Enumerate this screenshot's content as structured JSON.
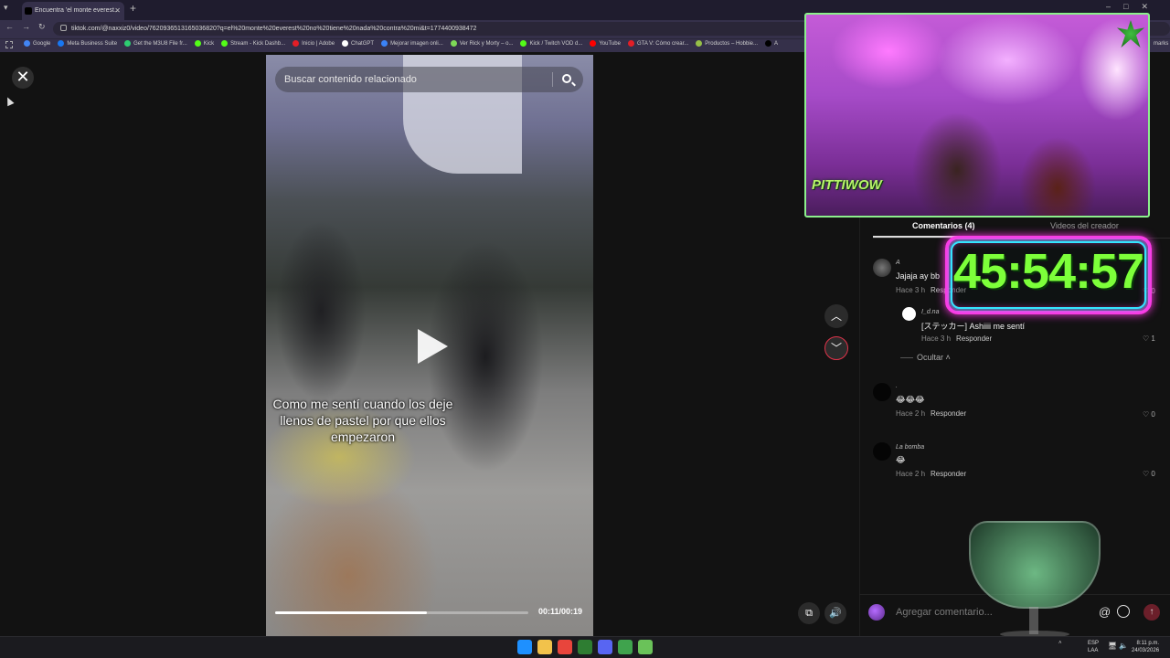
{
  "browser": {
    "tab_title": "Encuentra 'el monte everest...",
    "url": "tiktok.com/@naxxiz0/video/7620936513165036820?q=el%20monte%20everest%20no%20tiene%20nada%20contra%20mi&t=1774400938472",
    "bookmarks": [
      {
        "label": "Google",
        "color": "#4285f4"
      },
      {
        "label": "Meta Business Suite",
        "color": "#1877f2"
      },
      {
        "label": "Get the M3U8 File fr...",
        "color": "#2ecc71"
      },
      {
        "label": "Kick",
        "color": "#53fc18"
      },
      {
        "label": "Stream - Kick Dashb...",
        "color": "#53fc18"
      },
      {
        "label": "Inicio | Adobe",
        "color": "#e41e26"
      },
      {
        "label": "ChatGPT",
        "color": "#ffffff"
      },
      {
        "label": "Mejorar imagen onli...",
        "color": "#3b82f6"
      },
      {
        "label": "Ver Rick y Morty – o...",
        "color": "#7ed957"
      },
      {
        "label": "Kick / Twitch VOD d...",
        "color": "#53fc18"
      },
      {
        "label": "YouTube",
        "color": "#ff0000"
      },
      {
        "label": "GTA V: Cómo crear...",
        "color": "#e41e26"
      },
      {
        "label": "Productos – Hobbie...",
        "color": "#96bf48"
      },
      {
        "label": "A",
        "color": "#000000"
      }
    ],
    "bookmarks_end": "marks"
  },
  "video": {
    "search_placeholder": "Buscar contenido relacionado",
    "caption": "Como me sentí cuando los deje llenos de pastel por que ellos empezaron",
    "time": "00:11/00:19",
    "progress": 0.6
  },
  "panel": {
    "tab_comments": "Comentarios (4)",
    "tab_creator": "Videos del creador",
    "hide_replies": "Ocultar",
    "comments": [
      {
        "user": "A",
        "text": "Jajaja ay bb",
        "time": "Hace 3 h",
        "reply": "Responder",
        "likes": "0"
      },
      {
        "user": "I_d.na",
        "text": "[ステッカー] Ashiiii me sentí",
        "time": "Hace 3 h",
        "reply": "Responder",
        "likes": "1"
      },
      {
        "user": ".",
        "text": "😂😂😂",
        "time": "Hace 2 h",
        "reply": "Responder",
        "likes": "0"
      },
      {
        "user": "La bomba",
        "text": "😂",
        "time": "Hace 2 h",
        "reply": "Responder",
        "likes": "0"
      }
    ],
    "comment_placeholder": "Agregar comentario..."
  },
  "overlay": {
    "webcam_logo": "PITTIWOW",
    "timer": "45:54:57"
  },
  "taskbar": {
    "lang_top": "ESP",
    "lang_bottom": "LAA",
    "time": "8:11 p.m.",
    "date": "24/03/2026",
    "icon_colors": [
      "#1e90ff",
      "#f2c24b",
      "#e8453c",
      "#2e7d32",
      "#5865f2",
      "#3fa34d",
      "#6ac259"
    ]
  }
}
